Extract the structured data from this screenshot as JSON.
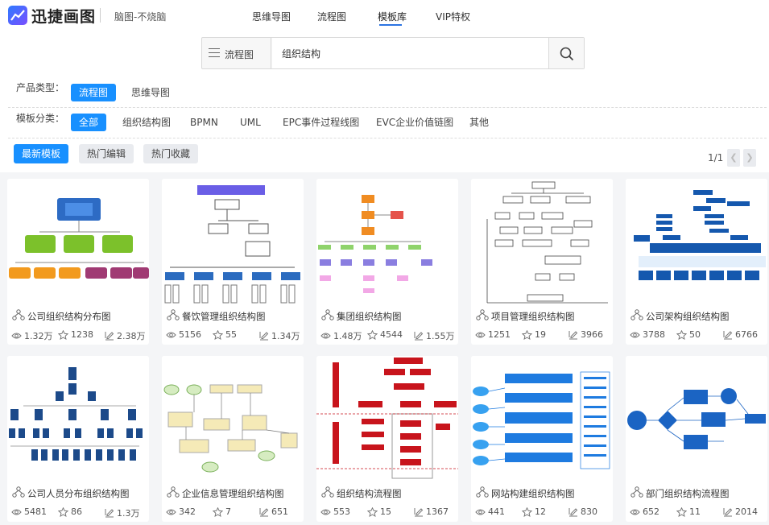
{
  "header": {
    "logo_text": "迅捷画图",
    "slogan": "脑图-不烧脑",
    "nav": [
      {
        "label": "思维导图"
      },
      {
        "label": "流程图"
      },
      {
        "label": "模板库"
      },
      {
        "label": "VIP特权"
      }
    ]
  },
  "search": {
    "category": "流程图",
    "value": "组织结构"
  },
  "filters": {
    "product_label": "产品类型：",
    "product_options": [
      "流程图",
      "思维导图"
    ],
    "category_label": "模板分类：",
    "category_options": [
      "全部",
      "组织结构图",
      "BPMN",
      "UML",
      "EPC事件过程线图",
      "EVC企业价值链图",
      "其他"
    ]
  },
  "sort": {
    "options": [
      "最新模板",
      "热门编辑",
      "热门收藏"
    ]
  },
  "pager": {
    "text": "1/1"
  },
  "cards": [
    {
      "title": "公司组织结构分布图",
      "views": "1.32万",
      "stars": "1238",
      "edits": "2.38万"
    },
    {
      "title": "餐饮管理组织结构图",
      "views": "5156",
      "stars": "55",
      "edits": "1.34万"
    },
    {
      "title": "集团组织结构图",
      "views": "1.48万",
      "stars": "4544",
      "edits": "1.55万"
    },
    {
      "title": "项目管理组织结构图",
      "views": "1251",
      "stars": "19",
      "edits": "3966"
    },
    {
      "title": "公司架构组织结构图",
      "views": "3788",
      "stars": "50",
      "edits": "6766"
    },
    {
      "title": "公司人员分布组织结构图",
      "views": "5481",
      "stars": "86",
      "edits": "1.3万"
    },
    {
      "title": "企业信息管理组织结构图",
      "views": "342",
      "stars": "7",
      "edits": "651"
    },
    {
      "title": "组织结构流程图",
      "views": "553",
      "stars": "15",
      "edits": "1367"
    },
    {
      "title": "网站构建组织结构图",
      "views": "441",
      "stars": "12",
      "edits": "830"
    },
    {
      "title": "部门组织结构流程图",
      "views": "652",
      "stars": "11",
      "edits": "2014"
    }
  ],
  "colors": {
    "accent": "#1890ff",
    "nav_active": "#2b74e2"
  }
}
